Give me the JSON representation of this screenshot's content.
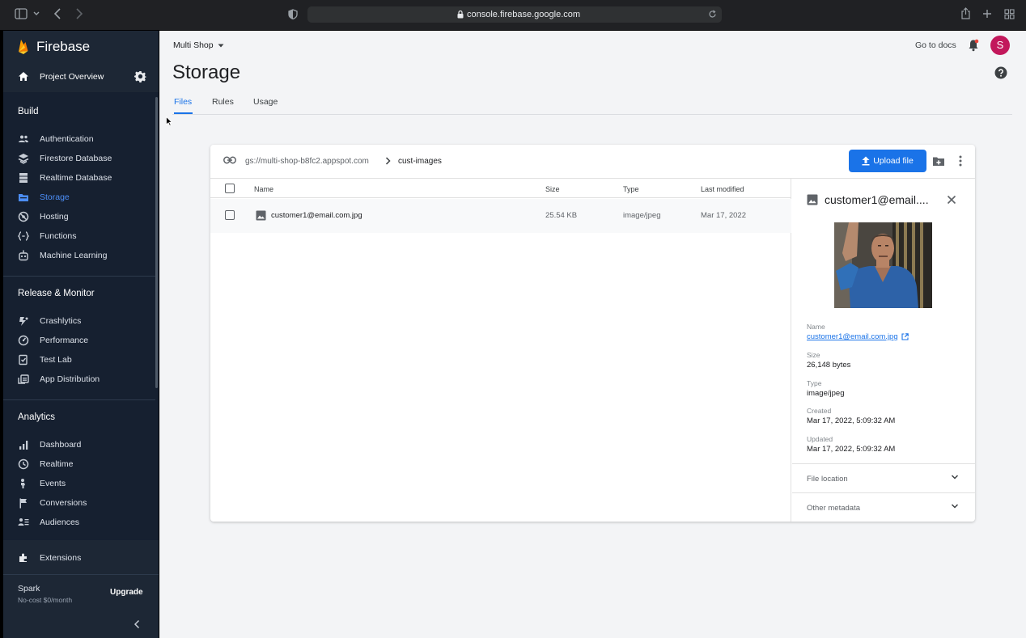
{
  "browser": {
    "url": "console.firebase.google.com"
  },
  "sidebar": {
    "brand": "Firebase",
    "project_overview": "Project Overview",
    "sections": [
      {
        "title": "Build"
      },
      {
        "title": "Release & Monitor"
      },
      {
        "title": "Analytics"
      }
    ],
    "build_items": [
      {
        "label": "Authentication",
        "icon": "people-icon"
      },
      {
        "label": "Firestore Database",
        "icon": "firestore-icon"
      },
      {
        "label": "Realtime Database",
        "icon": "database-icon"
      },
      {
        "label": "Storage",
        "icon": "storage-icon",
        "active": true
      },
      {
        "label": "Hosting",
        "icon": "hosting-icon"
      },
      {
        "label": "Functions",
        "icon": "functions-icon"
      },
      {
        "label": "Machine Learning",
        "icon": "robot-icon"
      }
    ],
    "release_items": [
      {
        "label": "Crashlytics",
        "icon": "crashlytics-icon"
      },
      {
        "label": "Performance",
        "icon": "performance-icon"
      },
      {
        "label": "Test Lab",
        "icon": "test-lab-icon"
      },
      {
        "label": "App Distribution",
        "icon": "app-distribution-icon"
      }
    ],
    "analytics_items": [
      {
        "label": "Dashboard",
        "icon": "bar-chart-icon"
      },
      {
        "label": "Realtime",
        "icon": "clock-icon"
      },
      {
        "label": "Events",
        "icon": "events-icon"
      },
      {
        "label": "Conversions",
        "icon": "flag-icon"
      },
      {
        "label": "Audiences",
        "icon": "audiences-icon"
      }
    ],
    "extensions": "Extensions",
    "plan_name": "Spark",
    "plan_cost": "No-cost $0/month",
    "upgrade": "Upgrade",
    "active_color": "#4c8ef7"
  },
  "header": {
    "project": "Multi Shop",
    "go_to_docs": "Go to docs",
    "avatar_initial": "S",
    "avatar_color": "#c2185b"
  },
  "page": {
    "title": "Storage",
    "tabs": [
      {
        "label": "Files",
        "active": true
      },
      {
        "label": "Rules"
      },
      {
        "label": "Usage"
      }
    ]
  },
  "browser_panel": {
    "bucket": "gs://multi-shop-b8fc2.appspot.com",
    "folder": "cust-images",
    "upload_label": "Upload file",
    "columns": {
      "name": "Name",
      "size": "Size",
      "type": "Type",
      "modified": "Last modified"
    },
    "rows": [
      {
        "name": "customer1@email.com.jpg",
        "size": "25.54 KB",
        "type": "image/jpeg",
        "modified": "Mar 17, 2022"
      }
    ]
  },
  "details": {
    "title": "customer1@email....",
    "fields": [
      {
        "key": "Name",
        "value": "customer1@email.com.jpg",
        "link": true
      },
      {
        "key": "Size",
        "value": "26,148 bytes"
      },
      {
        "key": "Type",
        "value": "image/jpeg"
      },
      {
        "key": "Created",
        "value": "Mar 17, 2022, 5:09:32 AM"
      },
      {
        "key": "Updated",
        "value": "Mar 17, 2022, 5:09:32 AM"
      }
    ],
    "sections": [
      {
        "label": "File location"
      },
      {
        "label": "Other metadata"
      }
    ],
    "accent": "#1a73e8"
  }
}
